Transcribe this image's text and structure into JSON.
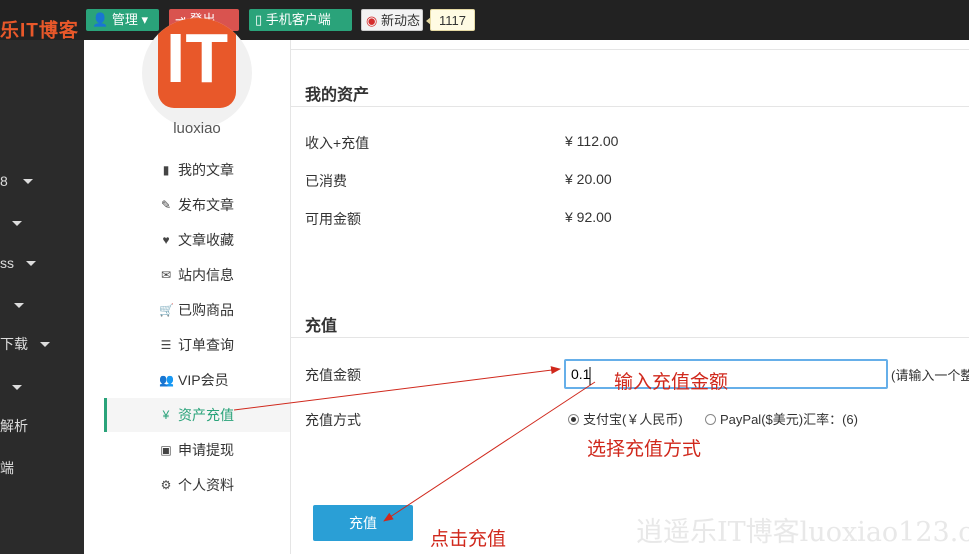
{
  "header": {
    "logo": "乐IT博客",
    "manage_label": "管理",
    "logout_label": "登出",
    "mobile_label": "手机客户端",
    "weibo_label": "新动态",
    "weibo_count": "1117"
  },
  "left_nav": {
    "items": [
      {
        "label": "8"
      },
      {
        "label": ""
      },
      {
        "label": "ss"
      },
      {
        "label": ""
      },
      {
        "label": "下载"
      },
      {
        "label": ""
      },
      {
        "label": "解析"
      },
      {
        "label": "端"
      }
    ]
  },
  "sidebar": {
    "avatar_text": "IT",
    "username": "luoxiao",
    "menu": [
      {
        "label": "我的文章",
        "icon": "book-icon",
        "glyph": "▮"
      },
      {
        "label": "发布文章",
        "icon": "edit-icon",
        "glyph": "✎"
      },
      {
        "label": "文章收藏",
        "icon": "heart-icon",
        "glyph": "♥"
      },
      {
        "label": "站内信息",
        "icon": "envelope-icon",
        "glyph": "✉"
      },
      {
        "label": "已购商品",
        "icon": "cart-icon",
        "glyph": "🛒"
      },
      {
        "label": "订单查询",
        "icon": "list-icon",
        "glyph": "☰"
      },
      {
        "label": "VIP会员",
        "icon": "users-icon",
        "glyph": "👥"
      },
      {
        "label": "资产充值",
        "icon": "yen-icon",
        "glyph": "¥"
      },
      {
        "label": "申请提现",
        "icon": "money-icon",
        "glyph": "▣"
      },
      {
        "label": "个人资料",
        "icon": "gear-icon",
        "glyph": "⚙"
      }
    ],
    "active_index": 7
  },
  "assets": {
    "title": "我的资产",
    "rows": [
      {
        "label": "收入+充值",
        "value": "¥  112.00"
      },
      {
        "label": "已消费",
        "value": "¥  20.00"
      },
      {
        "label": "可用金额",
        "value": "¥  92.00"
      }
    ]
  },
  "recharge": {
    "title": "充值",
    "amount_label": "充值金额",
    "amount_value": "0.1",
    "amount_hint": "(请输入一个整数",
    "method_label": "充值方式",
    "method_options": [
      {
        "label": "支付宝(￥人民币)",
        "selected": true
      },
      {
        "label": "PayPal($美元)汇率：(6)",
        "selected": false
      }
    ],
    "submit_label": "充值"
  },
  "annotations": {
    "enter_amount": "输入充值金额",
    "choose_method": "选择充值方式",
    "click_recharge": "点击充值"
  },
  "watermark": "逍遥乐IT博客luoxiao123.cn",
  "colors": {
    "accent_green": "#2aa37a",
    "danger_red": "#d9534f",
    "brand_orange": "#e8582a",
    "button_blue": "#2a9fd6",
    "annotation_red": "#d0281c"
  }
}
